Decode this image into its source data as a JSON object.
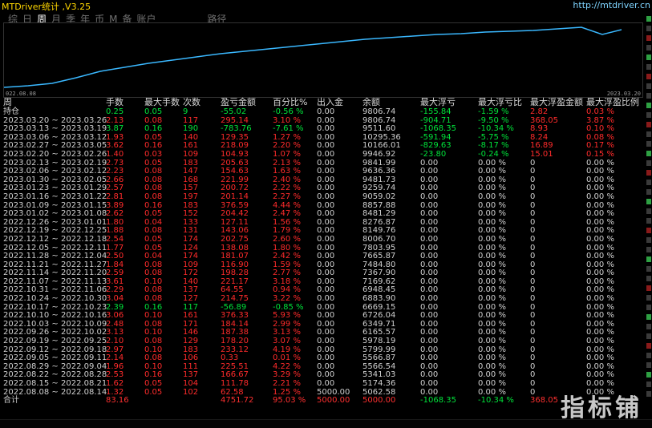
{
  "header": {
    "title": "MTDriver统计 ,V3.25",
    "url": "http://mtdriver.cn"
  },
  "tabs": [
    {
      "label": "综",
      "active": false
    },
    {
      "label": "日",
      "active": false
    },
    {
      "label": "周",
      "active": true
    },
    {
      "label": "月",
      "active": false
    },
    {
      "label": "季",
      "active": false
    },
    {
      "label": "年",
      "active": false
    },
    {
      "label": "币",
      "active": false
    },
    {
      "label": "M",
      "active": false
    },
    {
      "label": "备",
      "active": false
    },
    {
      "label": "账户",
      "active": false
    }
  ],
  "route_label": "路径",
  "equity_chart": {
    "start_label": "022.08.08",
    "end_label": "2023.03.20",
    "line_color": "#3ab8ff"
  },
  "columns": [
    "周",
    "手数",
    "最大手数",
    "次数",
    "盈亏金额",
    "百分比%",
    "出入金",
    "余额",
    "最大浮亏",
    "最大浮亏比",
    "最大浮盈金额",
    "最大浮盈比例"
  ],
  "holding_label": "持仓",
  "rows": [
    {
      "period": "",
      "lots": "0.25",
      "max_lots": "0.05",
      "count": "9",
      "pnl": "-55.02",
      "pct": "-0.56 %",
      "flow": "0.00",
      "balance": "9806.74",
      "max_dd": "-155.84",
      "max_dd_pct": "-1.59 %",
      "max_fp": "2.82",
      "max_fp_pct": "0.03 %",
      "color": "green",
      "hold": true
    },
    {
      "period": "2023.03.20 ~ 2023.03.26",
      "lots": "2.13",
      "max_lots": "0.08",
      "count": "117",
      "pnl": "295.14",
      "pct": "3.10 %",
      "flow": "0.00",
      "balance": "9806.74",
      "max_dd": "-904.71",
      "max_dd_pct": "-9.50 %",
      "max_fp": "368.05",
      "max_fp_pct": "3.87 %",
      "color": "red"
    },
    {
      "period": "2023.03.13 ~ 2023.03.19",
      "lots": "3.87",
      "max_lots": "0.16",
      "count": "190",
      "pnl": "-783.76",
      "pct": "-7.61 %",
      "flow": "0.00",
      "balance": "9511.60",
      "max_dd": "-1068.35",
      "max_dd_pct": "-10.34 %",
      "max_fp": "8.93",
      "max_fp_pct": "0.10 %",
      "color": "green"
    },
    {
      "period": "2023.03.06 ~ 2023.03.12",
      "lots": "1.93",
      "max_lots": "0.05",
      "count": "140",
      "pnl": "129.35",
      "pct": "1.27 %",
      "flow": "0.00",
      "balance": "10295.36",
      "max_dd": "-591.94",
      "max_dd_pct": "-5.75 %",
      "max_fp": "8.24",
      "max_fp_pct": "0.08 %",
      "color": "red"
    },
    {
      "period": "2023.02.27 ~ 2023.03.05",
      "lots": "3.62",
      "max_lots": "0.16",
      "count": "161",
      "pnl": "218.09",
      "pct": "2.20 %",
      "flow": "0.00",
      "balance": "10166.01",
      "max_dd": "-829.63",
      "max_dd_pct": "-8.17 %",
      "max_fp": "16.89",
      "max_fp_pct": "0.17 %",
      "color": "red"
    },
    {
      "period": "2023.02.20 ~ 2023.02.26",
      "lots": "1.40",
      "max_lots": "0.03",
      "count": "109",
      "pnl": "104.93",
      "pct": "1.07 %",
      "flow": "0.00",
      "balance": "9946.92",
      "max_dd": "-23.80",
      "max_dd_pct": "-0.24 %",
      "max_fp": "15.01",
      "max_fp_pct": "0.15 %",
      "color": "red"
    },
    {
      "period": "2023.02.13 ~ 2023.02.19",
      "lots": "2.73",
      "max_lots": "0.05",
      "count": "183",
      "pnl": "205.63",
      "pct": "2.13 %",
      "flow": "0.00",
      "balance": "9841.99",
      "max_dd": "0.00",
      "max_dd_pct": "0.00 %",
      "max_fp": "0",
      "max_fp_pct": "0.00 %",
      "color": "red"
    },
    {
      "period": "2023.02.06 ~ 2023.02.12",
      "lots": "2.23",
      "max_lots": "0.08",
      "count": "147",
      "pnl": "154.63",
      "pct": "1.63 %",
      "flow": "0.00",
      "balance": "9636.36",
      "max_dd": "0.00",
      "max_dd_pct": "0.00 %",
      "max_fp": "0",
      "max_fp_pct": "0.00 %",
      "color": "red"
    },
    {
      "period": "2023.01.30 ~ 2023.02.05",
      "lots": "2.66",
      "max_lots": "0.08",
      "count": "168",
      "pnl": "221.99",
      "pct": "2.40 %",
      "flow": "0.00",
      "balance": "9481.73",
      "max_dd": "0.00",
      "max_dd_pct": "0.00 %",
      "max_fp": "0",
      "max_fp_pct": "0.00 %",
      "color": "red"
    },
    {
      "period": "2023.01.23 ~ 2023.01.29",
      "lots": "2.57",
      "max_lots": "0.08",
      "count": "157",
      "pnl": "200.72",
      "pct": "2.22 %",
      "flow": "0.00",
      "balance": "9259.74",
      "max_dd": "0.00",
      "max_dd_pct": "0.00 %",
      "max_fp": "0",
      "max_fp_pct": "0.00 %",
      "color": "red"
    },
    {
      "period": "2023.01.16 ~ 2023.01.22",
      "lots": "2.81",
      "max_lots": "0.08",
      "count": "197",
      "pnl": "201.14",
      "pct": "2.27 %",
      "flow": "0.00",
      "balance": "9059.02",
      "max_dd": "0.00",
      "max_dd_pct": "0.00 %",
      "max_fp": "0",
      "max_fp_pct": "0.00 %",
      "color": "red"
    },
    {
      "period": "2023.01.09 ~ 2023.01.15",
      "lots": "3.89",
      "max_lots": "0.16",
      "count": "183",
      "pnl": "376.59",
      "pct": "4.44 %",
      "flow": "0.00",
      "balance": "8857.88",
      "max_dd": "0.00",
      "max_dd_pct": "0.00 %",
      "max_fp": "0",
      "max_fp_pct": "0.00 %",
      "color": "red"
    },
    {
      "period": "2023.01.02 ~ 2023.01.08",
      "lots": "2.62",
      "max_lots": "0.05",
      "count": "152",
      "pnl": "204.42",
      "pct": "2.47 %",
      "flow": "0.00",
      "balance": "8481.29",
      "max_dd": "0.00",
      "max_dd_pct": "0.00 %",
      "max_fp": "0",
      "max_fp_pct": "0.00 %",
      "color": "red"
    },
    {
      "period": "2022.12.26 ~ 2023.01.01",
      "lots": "1.80",
      "max_lots": "0.04",
      "count": "133",
      "pnl": "127.11",
      "pct": "1.56 %",
      "flow": "0.00",
      "balance": "8276.87",
      "max_dd": "0.00",
      "max_dd_pct": "0.00 %",
      "max_fp": "0",
      "max_fp_pct": "0.00 %",
      "color": "red"
    },
    {
      "period": "2022.12.19 ~ 2022.12.25",
      "lots": "1.88",
      "max_lots": "0.08",
      "count": "131",
      "pnl": "143.06",
      "pct": "1.79 %",
      "flow": "0.00",
      "balance": "8149.76",
      "max_dd": "0.00",
      "max_dd_pct": "0.00 %",
      "max_fp": "0",
      "max_fp_pct": "0.00 %",
      "color": "red"
    },
    {
      "period": "2022.12.12 ~ 2022.12.18",
      "lots": "2.54",
      "max_lots": "0.05",
      "count": "174",
      "pnl": "202.75",
      "pct": "2.60 %",
      "flow": "0.00",
      "balance": "8006.70",
      "max_dd": "0.00",
      "max_dd_pct": "0.00 %",
      "max_fp": "0",
      "max_fp_pct": "0.00 %",
      "color": "red"
    },
    {
      "period": "2022.12.05 ~ 2022.12.11",
      "lots": "1.77",
      "max_lots": "0.05",
      "count": "124",
      "pnl": "138.08",
      "pct": "1.80 %",
      "flow": "0.00",
      "balance": "7803.95",
      "max_dd": "0.00",
      "max_dd_pct": "0.00 %",
      "max_fp": "0",
      "max_fp_pct": "0.00 %",
      "color": "red"
    },
    {
      "period": "2022.11.28 ~ 2022.12.04",
      "lots": "2.50",
      "max_lots": "0.04",
      "count": "174",
      "pnl": "181.07",
      "pct": "2.42 %",
      "flow": "0.00",
      "balance": "7665.87",
      "max_dd": "0.00",
      "max_dd_pct": "0.00 %",
      "max_fp": "0",
      "max_fp_pct": "0.00 %",
      "color": "red"
    },
    {
      "period": "2022.11.21 ~ 2022.11.27",
      "lots": "1.84",
      "max_lots": "0.08",
      "count": "109",
      "pnl": "116.90",
      "pct": "1.59 %",
      "flow": "0.00",
      "balance": "7484.80",
      "max_dd": "0.00",
      "max_dd_pct": "0.00 %",
      "max_fp": "0",
      "max_fp_pct": "0.00 %",
      "color": "red"
    },
    {
      "period": "2022.11.14 ~ 2022.11.20",
      "lots": "2.59",
      "max_lots": "0.08",
      "count": "172",
      "pnl": "198.28",
      "pct": "2.77 %",
      "flow": "0.00",
      "balance": "7367.90",
      "max_dd": "0.00",
      "max_dd_pct": "0.00 %",
      "max_fp": "0",
      "max_fp_pct": "0.00 %",
      "color": "red"
    },
    {
      "period": "2022.11.07 ~ 2022.11.13",
      "lots": "3.61",
      "max_lots": "0.10",
      "count": "140",
      "pnl": "221.17",
      "pct": "3.18 %",
      "flow": "0.00",
      "balance": "7169.62",
      "max_dd": "0.00",
      "max_dd_pct": "0.00 %",
      "max_fp": "0",
      "max_fp_pct": "0.00 %",
      "color": "red"
    },
    {
      "period": "2022.10.31 ~ 2022.11.06",
      "lots": "2.29",
      "max_lots": "0.08",
      "count": "137",
      "pnl": "64.55",
      "pct": "0.94 %",
      "flow": "0.00",
      "balance": "6948.45",
      "max_dd": "0.00",
      "max_dd_pct": "0.00 %",
      "max_fp": "0",
      "max_fp_pct": "0.00 %",
      "color": "red"
    },
    {
      "period": "2022.10.24 ~ 2022.10.30",
      "lots": "3.04",
      "max_lots": "0.08",
      "count": "127",
      "pnl": "214.75",
      "pct": "3.22 %",
      "flow": "0.00",
      "balance": "6883.90",
      "max_dd": "0.00",
      "max_dd_pct": "0.00 %",
      "max_fp": "0",
      "max_fp_pct": "0.00 %",
      "color": "red"
    },
    {
      "period": "2022.10.17 ~ 2022.10.23",
      "lots": "2.39",
      "max_lots": "0.16",
      "count": "117",
      "pnl": "-56.89",
      "pct": "-0.85 %",
      "flow": "0.00",
      "balance": "6669.15",
      "max_dd": "0.00",
      "max_dd_pct": "0.00 %",
      "max_fp": "0",
      "max_fp_pct": "0.00 %",
      "color": "green"
    },
    {
      "period": "2022.10.10 ~ 2022.10.16",
      "lots": "3.06",
      "max_lots": "0.10",
      "count": "161",
      "pnl": "376.33",
      "pct": "5.93 %",
      "flow": "0.00",
      "balance": "6726.04",
      "max_dd": "0.00",
      "max_dd_pct": "0.00 %",
      "max_fp": "0",
      "max_fp_pct": "0.00 %",
      "color": "red"
    },
    {
      "period": "2022.10.03 ~ 2022.10.09",
      "lots": "2.48",
      "max_lots": "0.08",
      "count": "171",
      "pnl": "184.14",
      "pct": "2.99 %",
      "flow": "0.00",
      "balance": "6349.71",
      "max_dd": "0.00",
      "max_dd_pct": "0.00 %",
      "max_fp": "0",
      "max_fp_pct": "0.00 %",
      "color": "red"
    },
    {
      "period": "2022.09.26 ~ 2022.10.02",
      "lots": "3.13",
      "max_lots": "0.10",
      "count": "146",
      "pnl": "187.38",
      "pct": "3.13 %",
      "flow": "0.00",
      "balance": "6165.57",
      "max_dd": "0.00",
      "max_dd_pct": "0.00 %",
      "max_fp": "0",
      "max_fp_pct": "0.00 %",
      "color": "red"
    },
    {
      "period": "2022.09.19 ~ 2022.09.25",
      "lots": "2.10",
      "max_lots": "0.08",
      "count": "129",
      "pnl": "178.20",
      "pct": "3.07 %",
      "flow": "0.00",
      "balance": "5978.19",
      "max_dd": "0.00",
      "max_dd_pct": "0.00 %",
      "max_fp": "0",
      "max_fp_pct": "0.00 %",
      "color": "red"
    },
    {
      "period": "2022.09.12 ~ 2022.09.18",
      "lots": "2.97",
      "max_lots": "0.10",
      "count": "183",
      "pnl": "233.12",
      "pct": "4.19 %",
      "flow": "0.00",
      "balance": "5799.99",
      "max_dd": "0.00",
      "max_dd_pct": "0.00 %",
      "max_fp": "0",
      "max_fp_pct": "0.00 %",
      "color": "red"
    },
    {
      "period": "2022.09.05 ~ 2022.09.11",
      "lots": "2.14",
      "max_lots": "0.08",
      "count": "106",
      "pnl": "0.33",
      "pct": "0.01 %",
      "flow": "0.00",
      "balance": "5566.87",
      "max_dd": "0.00",
      "max_dd_pct": "0.00 %",
      "max_fp": "0",
      "max_fp_pct": "0.00 %",
      "color": "red"
    },
    {
      "period": "2022.08.29 ~ 2022.09.04",
      "lots": "1.96",
      "max_lots": "0.10",
      "count": "111",
      "pnl": "225.51",
      "pct": "4.22 %",
      "flow": "0.00",
      "balance": "5566.54",
      "max_dd": "0.00",
      "max_dd_pct": "0.00 %",
      "max_fp": "0",
      "max_fp_pct": "0.00 %",
      "color": "red"
    },
    {
      "period": "2022.08.22 ~ 2022.08.28",
      "lots": "2.53",
      "max_lots": "0.16",
      "count": "137",
      "pnl": "166.67",
      "pct": "3.29 %",
      "flow": "0.00",
      "balance": "5341.03",
      "max_dd": "0.00",
      "max_dd_pct": "0.00 %",
      "max_fp": "0",
      "max_fp_pct": "0.00 %",
      "color": "red"
    },
    {
      "period": "2022.08.15 ~ 2022.08.21",
      "lots": "1.62",
      "max_lots": "0.05",
      "count": "104",
      "pnl": "111.78",
      "pct": "2.21 %",
      "flow": "0.00",
      "balance": "5174.36",
      "max_dd": "0.00",
      "max_dd_pct": "0.00 %",
      "max_fp": "0",
      "max_fp_pct": "0.00 %",
      "color": "red"
    },
    {
      "period": "2022.08.08 ~ 2022.08.14",
      "lots": "1.32",
      "max_lots": "0.05",
      "count": "102",
      "pnl": "62.58",
      "pct": "1.25 %",
      "flow": "5000.00",
      "balance": "5062.58",
      "max_dd": "0.00",
      "max_dd_pct": "0.00 %",
      "max_fp": "0",
      "max_fp_pct": "0.00 %",
      "color": "red"
    }
  ],
  "total": {
    "label": "合计",
    "lots": "83.16",
    "pnl": "4751.72",
    "pct": "95.03 %",
    "flow": "5000.00",
    "balance": "5000.00",
    "max_dd": "-1068.35",
    "max_dd_pct": "-10.34 %",
    "max_fp": "368.05"
  },
  "watermark": "指标铺"
}
